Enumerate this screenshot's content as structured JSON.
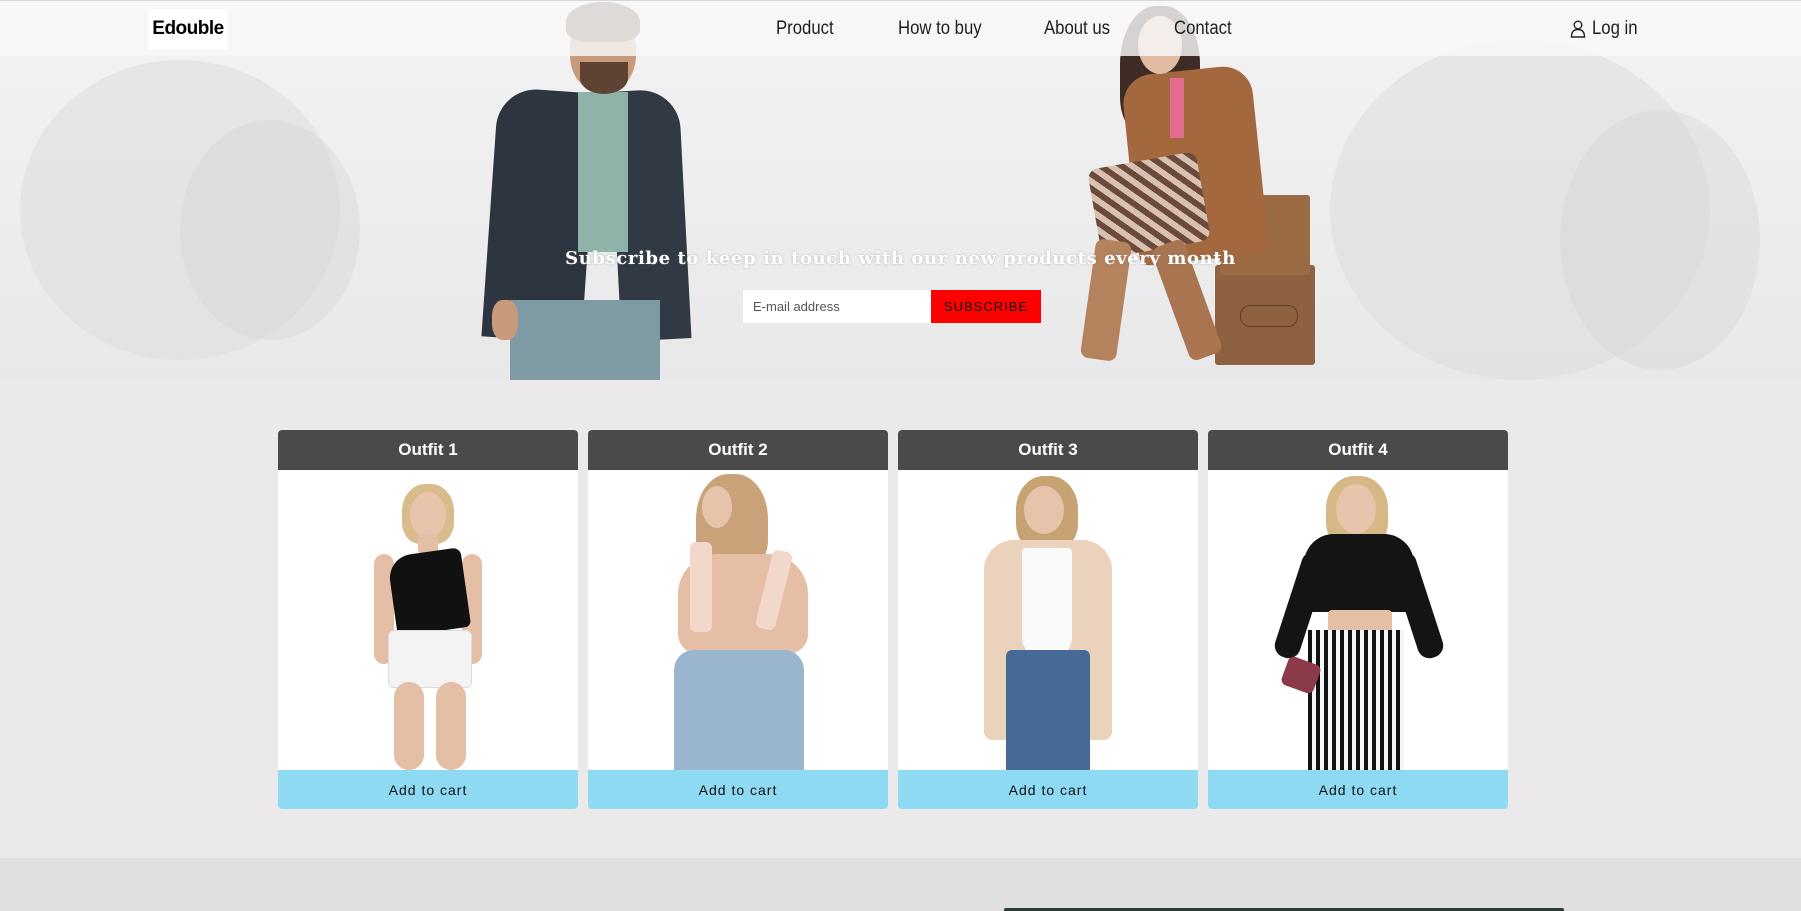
{
  "brand": {
    "logo_text": "Edouble"
  },
  "nav": {
    "items": [
      {
        "label": "Product"
      },
      {
        "label": "How to buy"
      },
      {
        "label": "About us"
      },
      {
        "label": "Contact"
      }
    ],
    "login_label": "Log in",
    "login_icon": "user-icon"
  },
  "hero": {
    "subscribe_title": "Subscribe to keep in touch with our new products every month",
    "email_placeholder": "E-mail address",
    "email_value": "",
    "subscribe_button": "SUBSCRIBE",
    "accent_color": "#ff0000"
  },
  "products": [
    {
      "title": "Outfit 1",
      "button": "Add to cart"
    },
    {
      "title": "Outfit 2",
      "button": "Add to cart"
    },
    {
      "title": "Outfit 3",
      "button": "Add to cart"
    },
    {
      "title": "Outfit 4",
      "button": "Add to cart"
    }
  ],
  "colors": {
    "card_header": "#4a4a4a",
    "cart_button": "#8ddaf2",
    "page_background": "#ebe9ea"
  }
}
